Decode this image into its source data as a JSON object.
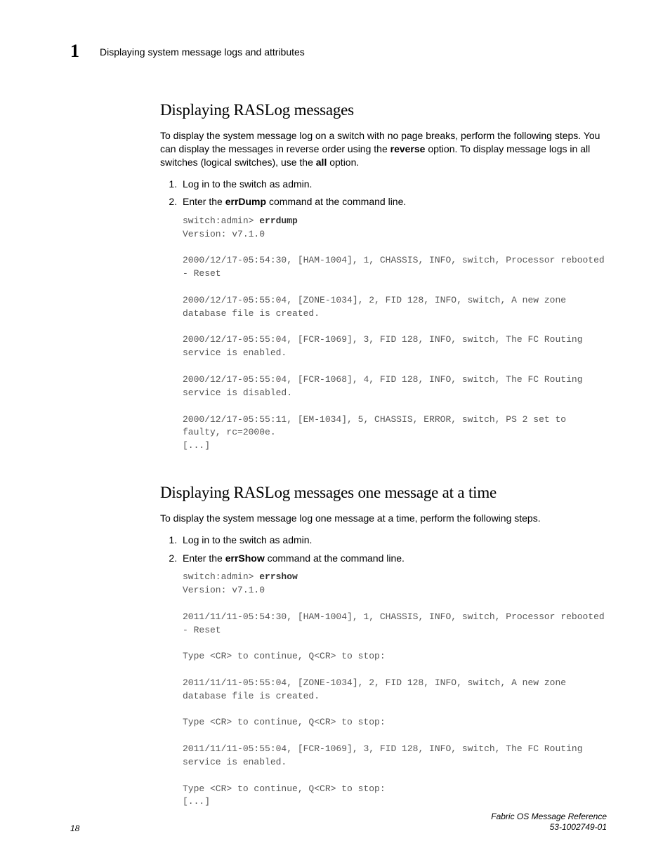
{
  "header": {
    "chapter_num": "1",
    "running_title": "Displaying system message logs and attributes"
  },
  "section1": {
    "heading": "Displaying RASLog messages",
    "intro_parts": [
      "To display the system message log on a switch with no page breaks, perform the following steps. You can display the messages in reverse order using the ",
      "reverse",
      " option. To display message logs in all switches (logical switches), use the ",
      "all",
      " option."
    ],
    "step1": "Log in to the switch as admin.",
    "step2_pre": "Enter the ",
    "step2_cmd": "errDump",
    "step2_post": " command at the command line.",
    "term_prompt": "switch:admin> ",
    "term_cmd": "errdump",
    "term_rest": "Version: v7.1.0\n\n2000/12/17-05:54:30, [HAM-1004], 1, CHASSIS, INFO, switch, Processor rebooted - Reset\n\n2000/12/17-05:55:04, [ZONE-1034], 2, FID 128, INFO, switch, A new zone database file is created.\n\n2000/12/17-05:55:04, [FCR-1069], 3, FID 128, INFO, switch, The FC Routing service is enabled.\n\n2000/12/17-05:55:04, [FCR-1068], 4, FID 128, INFO, switch, The FC Routing service is disabled.\n\n2000/12/17-05:55:11, [EM-1034], 5, CHASSIS, ERROR, switch, PS 2 set to faulty, rc=2000e.\n[...]"
  },
  "section2": {
    "heading": "Displaying RASLog messages one message at a time",
    "intro": "To display the system message log one message at a time, perform the following steps.",
    "step1": "Log in to the switch as admin.",
    "step2_pre": "Enter the ",
    "step2_cmd": "errShow",
    "step2_post": " command at the command line.",
    "term_prompt": "switch:admin> ",
    "term_cmd": "errshow",
    "term_rest": "Version: v7.1.0\n\n2011/11/11-05:54:30, [HAM-1004], 1, CHASSIS, INFO, switch, Processor rebooted - Reset\n\nType <CR> to continue, Q<CR> to stop:\n\n2011/11/11-05:55:04, [ZONE-1034], 2, FID 128, INFO, switch, A new zone database file is created.\n\nType <CR> to continue, Q<CR> to stop:\n\n2011/11/11-05:55:04, [FCR-1069], 3, FID 128, INFO, switch, The FC Routing service is enabled.\n\nType <CR> to continue, Q<CR> to stop:\n[...]"
  },
  "footer": {
    "page_num": "18",
    "doc_title": "Fabric OS Message Reference",
    "doc_id": "53-1002749-01"
  }
}
